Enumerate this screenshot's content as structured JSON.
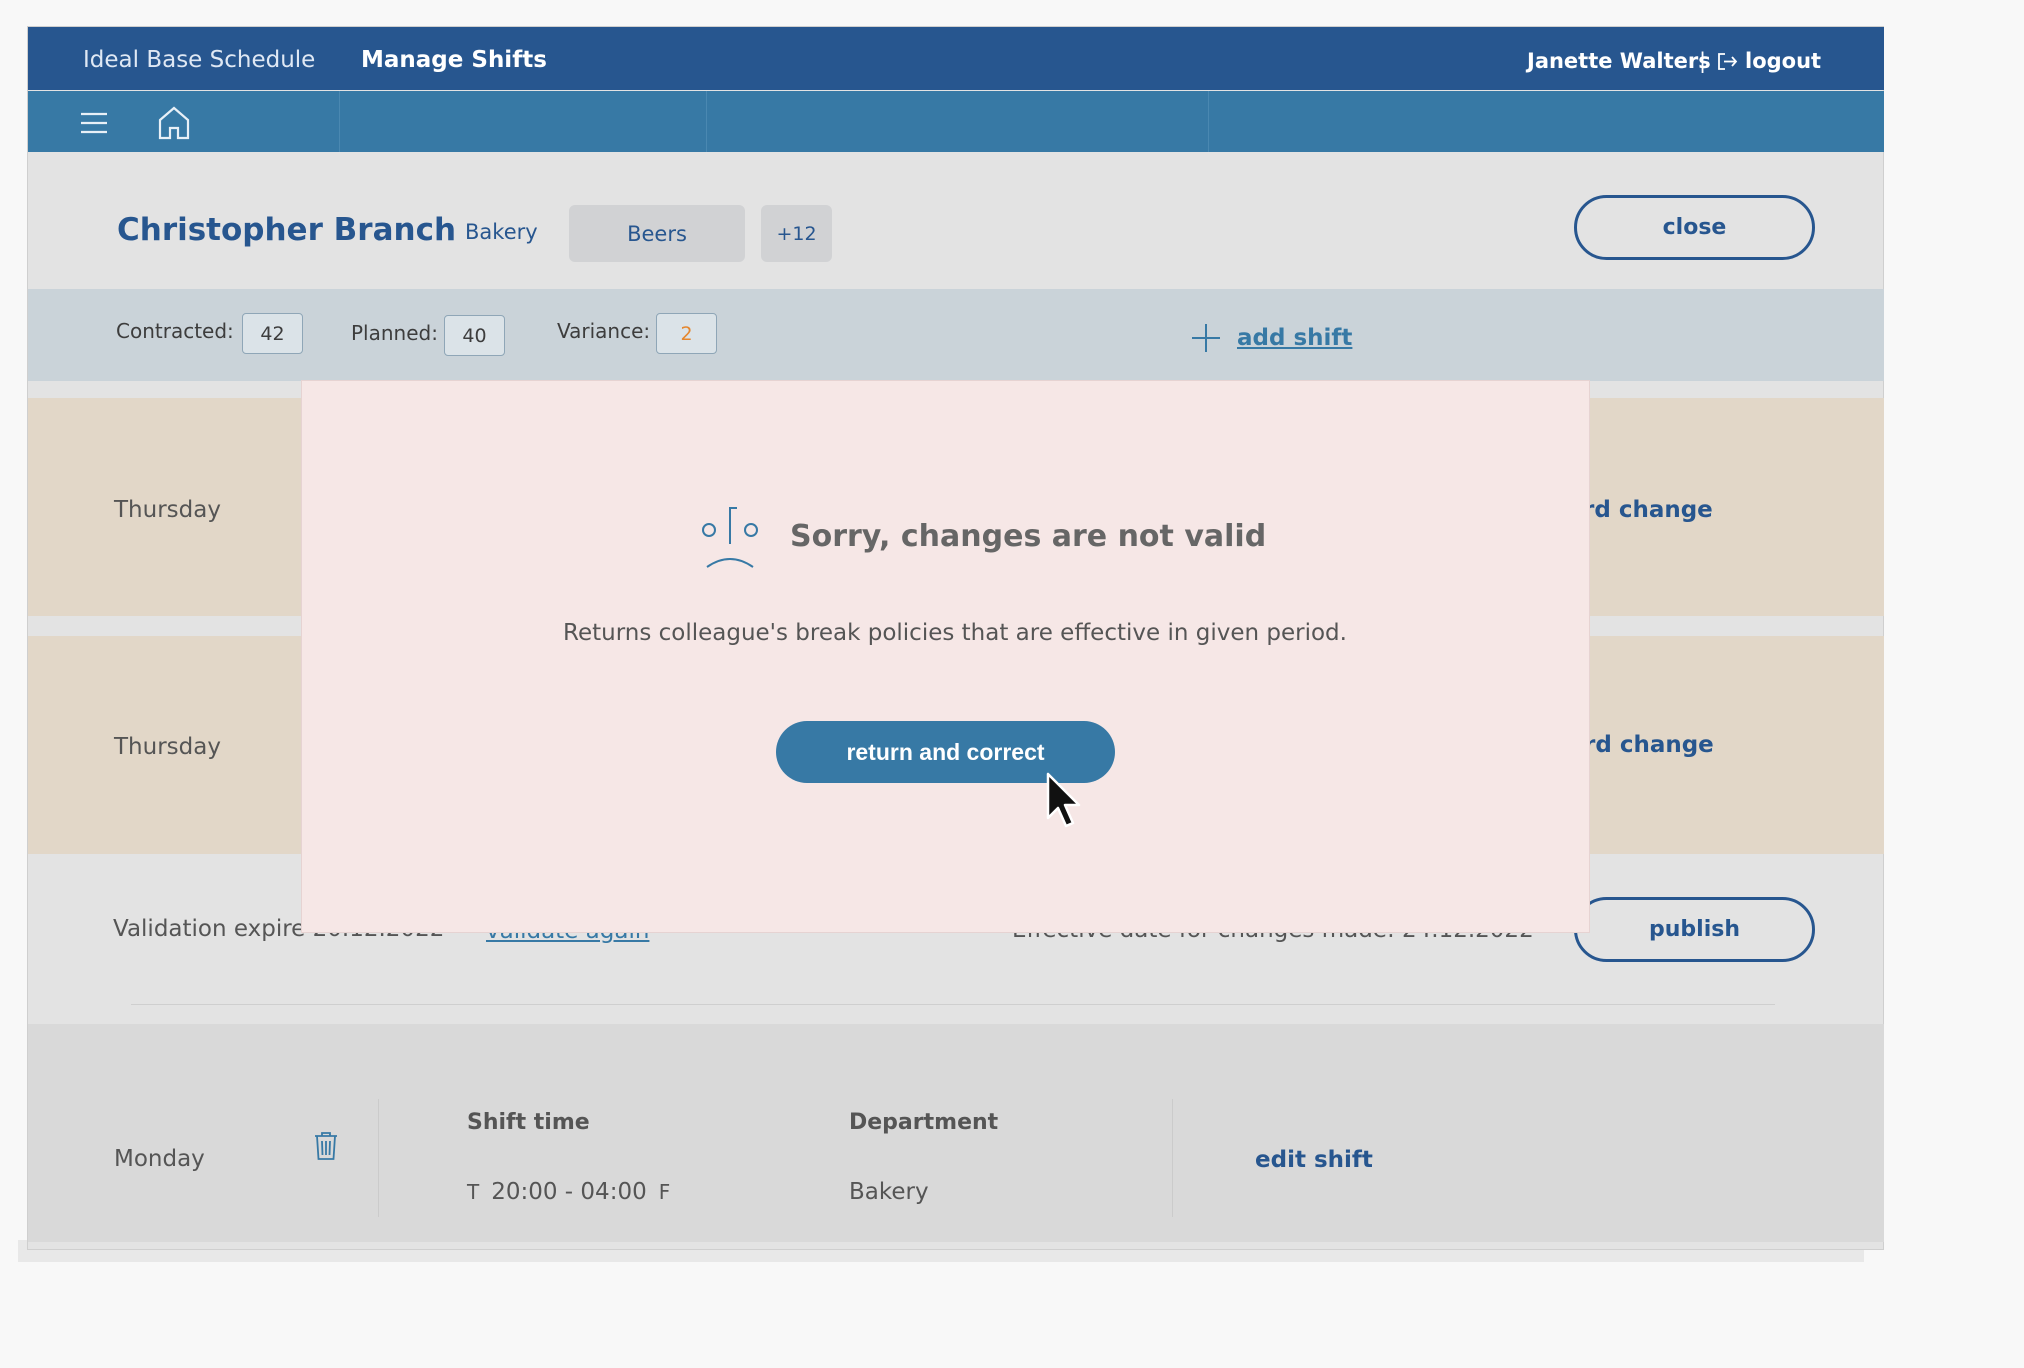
{
  "colors": {
    "primary_dark": "#27568f",
    "primary": "#3779a5",
    "tan_row": "#e2d7c8",
    "stats_band": "#cad3d9",
    "modal_bg": "#f6e7e6",
    "variance_accent": "#e5872e"
  },
  "header": {
    "app_title": "Ideal Base Schedule",
    "section_title": "Manage Shifts",
    "user_name": "Janette Walters",
    "separator": "|",
    "logout_label": "logout",
    "logout_icon": "logout-icon"
  },
  "nav": {
    "menu_icon": "hamburger-menu-icon",
    "home_icon": "home-icon"
  },
  "employee": {
    "name": "Christopher Branch",
    "department": "Bakery",
    "tag": "Beers",
    "more_tags": "+12",
    "close_label": "close"
  },
  "stats": {
    "contracted_label": "Contracted:",
    "contracted_value": "42",
    "planned_label": "Planned:",
    "planned_value": "40",
    "variance_label": "Variance:",
    "variance_value": "2",
    "add_shift_label": "add shift"
  },
  "rows": [
    {
      "day": "Thursday",
      "action": "rd change"
    },
    {
      "day": "Thursday",
      "action": "rd change"
    }
  ],
  "validation": {
    "expire_text": "Validation expire 20.12.2022",
    "validate_again": "validate again",
    "effective_text": "Effective date for changes made: 24.12.2022",
    "publish_label": "publish"
  },
  "shift": {
    "day": "Monday",
    "time_header": "Shift time",
    "time_prefix": "T",
    "time_value": "20:00 - 04:00",
    "time_suffix": "F",
    "department_header": "Department",
    "department_value": "Bakery",
    "edit_label": "edit shift"
  },
  "modal": {
    "icon": "sad-face-icon",
    "title": "Sorry, changes are not valid",
    "message": "Returns colleague's break policies that are effective in given period.",
    "button_label": "return and correct"
  }
}
